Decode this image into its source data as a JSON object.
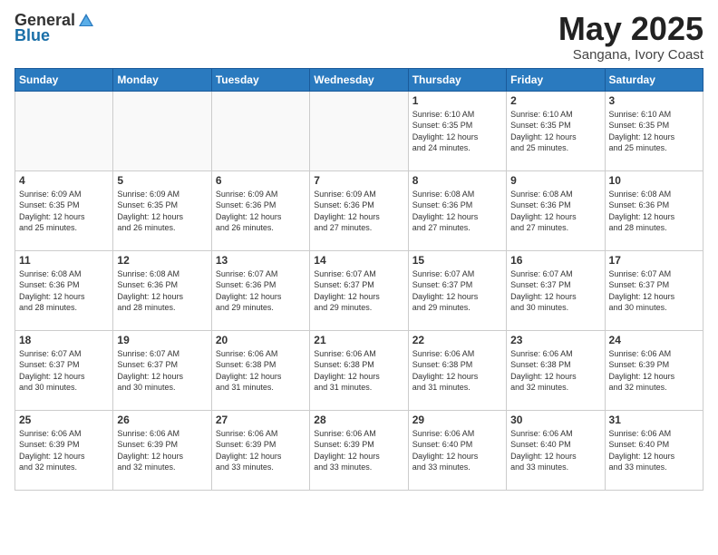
{
  "logo": {
    "general": "General",
    "blue": "Blue"
  },
  "title": {
    "month": "May 2025",
    "location": "Sangana, Ivory Coast"
  },
  "weekdays": [
    "Sunday",
    "Monday",
    "Tuesday",
    "Wednesday",
    "Thursday",
    "Friday",
    "Saturday"
  ],
  "weeks": [
    [
      {
        "day": "",
        "info": ""
      },
      {
        "day": "",
        "info": ""
      },
      {
        "day": "",
        "info": ""
      },
      {
        "day": "",
        "info": ""
      },
      {
        "day": "1",
        "info": "Sunrise: 6:10 AM\nSunset: 6:35 PM\nDaylight: 12 hours\nand 24 minutes."
      },
      {
        "day": "2",
        "info": "Sunrise: 6:10 AM\nSunset: 6:35 PM\nDaylight: 12 hours\nand 25 minutes."
      },
      {
        "day": "3",
        "info": "Sunrise: 6:10 AM\nSunset: 6:35 PM\nDaylight: 12 hours\nand 25 minutes."
      }
    ],
    [
      {
        "day": "4",
        "info": "Sunrise: 6:09 AM\nSunset: 6:35 PM\nDaylight: 12 hours\nand 25 minutes."
      },
      {
        "day": "5",
        "info": "Sunrise: 6:09 AM\nSunset: 6:35 PM\nDaylight: 12 hours\nand 26 minutes."
      },
      {
        "day": "6",
        "info": "Sunrise: 6:09 AM\nSunset: 6:36 PM\nDaylight: 12 hours\nand 26 minutes."
      },
      {
        "day": "7",
        "info": "Sunrise: 6:09 AM\nSunset: 6:36 PM\nDaylight: 12 hours\nand 27 minutes."
      },
      {
        "day": "8",
        "info": "Sunrise: 6:08 AM\nSunset: 6:36 PM\nDaylight: 12 hours\nand 27 minutes."
      },
      {
        "day": "9",
        "info": "Sunrise: 6:08 AM\nSunset: 6:36 PM\nDaylight: 12 hours\nand 27 minutes."
      },
      {
        "day": "10",
        "info": "Sunrise: 6:08 AM\nSunset: 6:36 PM\nDaylight: 12 hours\nand 28 minutes."
      }
    ],
    [
      {
        "day": "11",
        "info": "Sunrise: 6:08 AM\nSunset: 6:36 PM\nDaylight: 12 hours\nand 28 minutes."
      },
      {
        "day": "12",
        "info": "Sunrise: 6:08 AM\nSunset: 6:36 PM\nDaylight: 12 hours\nand 28 minutes."
      },
      {
        "day": "13",
        "info": "Sunrise: 6:07 AM\nSunset: 6:36 PM\nDaylight: 12 hours\nand 29 minutes."
      },
      {
        "day": "14",
        "info": "Sunrise: 6:07 AM\nSunset: 6:37 PM\nDaylight: 12 hours\nand 29 minutes."
      },
      {
        "day": "15",
        "info": "Sunrise: 6:07 AM\nSunset: 6:37 PM\nDaylight: 12 hours\nand 29 minutes."
      },
      {
        "day": "16",
        "info": "Sunrise: 6:07 AM\nSunset: 6:37 PM\nDaylight: 12 hours\nand 30 minutes."
      },
      {
        "day": "17",
        "info": "Sunrise: 6:07 AM\nSunset: 6:37 PM\nDaylight: 12 hours\nand 30 minutes."
      }
    ],
    [
      {
        "day": "18",
        "info": "Sunrise: 6:07 AM\nSunset: 6:37 PM\nDaylight: 12 hours\nand 30 minutes."
      },
      {
        "day": "19",
        "info": "Sunrise: 6:07 AM\nSunset: 6:37 PM\nDaylight: 12 hours\nand 30 minutes."
      },
      {
        "day": "20",
        "info": "Sunrise: 6:06 AM\nSunset: 6:38 PM\nDaylight: 12 hours\nand 31 minutes."
      },
      {
        "day": "21",
        "info": "Sunrise: 6:06 AM\nSunset: 6:38 PM\nDaylight: 12 hours\nand 31 minutes."
      },
      {
        "day": "22",
        "info": "Sunrise: 6:06 AM\nSunset: 6:38 PM\nDaylight: 12 hours\nand 31 minutes."
      },
      {
        "day": "23",
        "info": "Sunrise: 6:06 AM\nSunset: 6:38 PM\nDaylight: 12 hours\nand 32 minutes."
      },
      {
        "day": "24",
        "info": "Sunrise: 6:06 AM\nSunset: 6:39 PM\nDaylight: 12 hours\nand 32 minutes."
      }
    ],
    [
      {
        "day": "25",
        "info": "Sunrise: 6:06 AM\nSunset: 6:39 PM\nDaylight: 12 hours\nand 32 minutes."
      },
      {
        "day": "26",
        "info": "Sunrise: 6:06 AM\nSunset: 6:39 PM\nDaylight: 12 hours\nand 32 minutes."
      },
      {
        "day": "27",
        "info": "Sunrise: 6:06 AM\nSunset: 6:39 PM\nDaylight: 12 hours\nand 33 minutes."
      },
      {
        "day": "28",
        "info": "Sunrise: 6:06 AM\nSunset: 6:39 PM\nDaylight: 12 hours\nand 33 minutes."
      },
      {
        "day": "29",
        "info": "Sunrise: 6:06 AM\nSunset: 6:40 PM\nDaylight: 12 hours\nand 33 minutes."
      },
      {
        "day": "30",
        "info": "Sunrise: 6:06 AM\nSunset: 6:40 PM\nDaylight: 12 hours\nand 33 minutes."
      },
      {
        "day": "31",
        "info": "Sunrise: 6:06 AM\nSunset: 6:40 PM\nDaylight: 12 hours\nand 33 minutes."
      }
    ]
  ]
}
